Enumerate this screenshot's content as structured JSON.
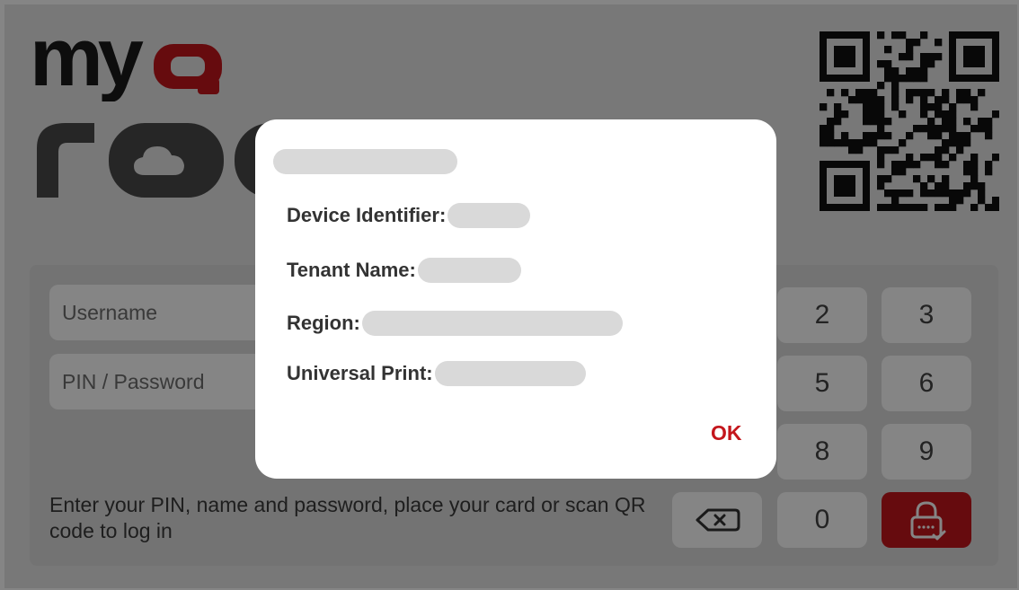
{
  "brand": {
    "logo_top": "myq",
    "logo_bottom": "roq",
    "accent": "#c4161c"
  },
  "login": {
    "username_placeholder": "Username",
    "pin_placeholder": "PIN / Password",
    "hint": "Enter your PIN, name and password, place your card or scan QR code to log in"
  },
  "keypad": {
    "keys": [
      "2",
      "3",
      "5",
      "6",
      "8",
      "9",
      "0"
    ],
    "backspace_icon": "backspace-icon",
    "login_icon": "lock-check-icon"
  },
  "dialog": {
    "title": "",
    "rows": [
      {
        "label": "Device Identifier:",
        "value": ""
      },
      {
        "label": "Tenant Name:",
        "value": ""
      },
      {
        "label": "Region:",
        "value": ""
      },
      {
        "label": "Universal Print:",
        "value": ""
      }
    ],
    "ok_label": "OK"
  }
}
